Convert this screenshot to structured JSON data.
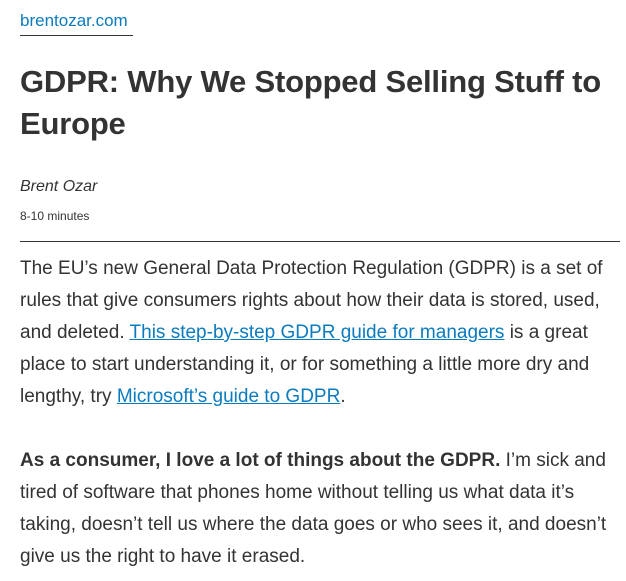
{
  "site": {
    "name": "brentozar.com"
  },
  "article": {
    "title": "GDPR: Why We Stopped Selling Stuff to Europe",
    "author": "Brent Ozar",
    "read_time": "8-10 minutes",
    "paragraph1": {
      "text_before_link1": "The EU’s new General Data Protection Regulation (GDPR) is a set of rules that give consumers rights about how their data is stored, used, and deleted. ",
      "link1": "This step-by-step GDPR guide for managers",
      "text_between_links": " is a great place to start understanding it, or for something a little more dry and lengthy, try ",
      "link2": "Microsoft’s guide to GDPR",
      "text_after_link2": "."
    },
    "paragraph2": {
      "bold_lead": "As a consumer, I love a lot of things about the GDPR.",
      "text": " I’m sick and tired of software that phones home without telling us what data it’s taking, doesn’t tell us where the data goes or who sees it, and doesn’t give us the right to have it erased."
    }
  },
  "colors": {
    "link": "#0b7bbf",
    "text": "#333333",
    "background": "#ffffff"
  }
}
